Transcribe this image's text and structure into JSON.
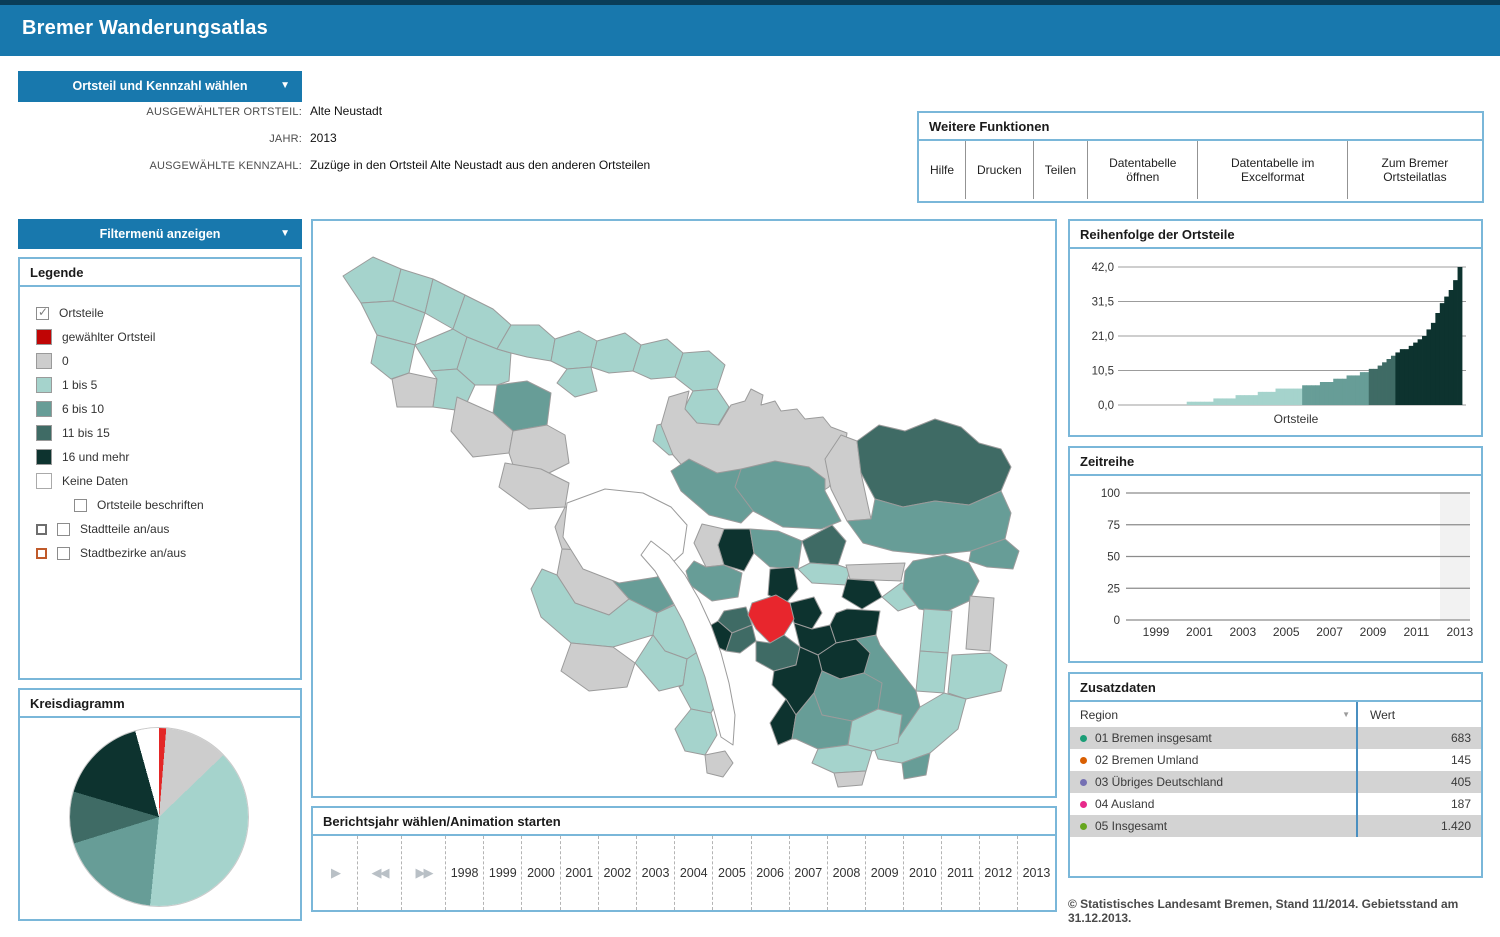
{
  "app": {
    "title": "Bremer Wanderungsatlas"
  },
  "selector": {
    "label": "Ortsteil und Kennzahl wählen",
    "caret": "▼"
  },
  "filter": {
    "label": "Filtermenü anzeigen",
    "caret": "▼"
  },
  "info": {
    "fields": [
      {
        "label": "AUSGEWÄHLTER ORTSTEIL:",
        "value": "Alte Neustadt"
      },
      {
        "label": "JAHR:",
        "value": "2013"
      },
      {
        "label": "AUSGEWÄHLTE KENNZAHL:",
        "value": "Zuzüge in den Ortsteil Alte Neustadt aus den anderen Ortsteilen"
      }
    ]
  },
  "panels": {
    "functions": "Weitere Funktionen",
    "legend": "Legende",
    "pie": "Kreisdiagramm",
    "ranking": "Reihenfolge der Ortsteile",
    "zeit": "Zeitreihe",
    "zusatz": "Zusatzdaten",
    "yearbar": "Berichtsjahr wählen/Animation starten"
  },
  "functions": {
    "buttons": [
      "Hilfe",
      "Drucken",
      "Teilen",
      "Datentabelle öffnen",
      "Datentabelle im Excelformat",
      "Zum Bremer Ortsteilatlas"
    ]
  },
  "legend": {
    "items": [
      {
        "kind": "check",
        "checked": true,
        "label": "Ortsteile"
      },
      {
        "kind": "swatch",
        "color": "#c00505",
        "label": "gewählter Ortsteil"
      },
      {
        "kind": "swatch",
        "color": "#cdcdcd",
        "label": "0"
      },
      {
        "kind": "swatch",
        "color": "#a5d3cc",
        "label": "1 bis 5"
      },
      {
        "kind": "swatch",
        "color": "#679d97",
        "label": "6 bis 10"
      },
      {
        "kind": "swatch",
        "color": "#3f6b65",
        "label": "11 bis 15"
      },
      {
        "kind": "swatch",
        "color": "#0d332f",
        "label": "16 und mehr"
      },
      {
        "kind": "swatch",
        "color": "#ffffff",
        "label": "Keine Daten"
      },
      {
        "kind": "sub-check",
        "label": "Ortsteile beschriften"
      },
      {
        "kind": "pair",
        "box": "#6e6e6e",
        "label": "Stadtteile an/aus"
      },
      {
        "kind": "pair",
        "box": "#c05a2a",
        "label": "Stadtbezirke an/aus"
      }
    ]
  },
  "chart_data": [
    {
      "id": "ranking",
      "type": "bar",
      "title": "Reihenfolge der Ortsteile",
      "xlabel": "Ortsteile",
      "ylim": [
        0,
        42
      ],
      "ytick_labels": [
        "0,0",
        "10,5",
        "21,0",
        "31,5",
        "42,0"
      ],
      "yticks": [
        0,
        10.5,
        21,
        31.5,
        42
      ],
      "grid": true,
      "sorted": "ascending",
      "values": [
        0,
        0,
        0,
        0,
        0,
        0,
        0,
        0,
        0,
        0,
        0,
        0,
        0,
        1,
        1,
        1,
        1,
        1,
        1,
        2,
        2,
        2,
        2,
        2,
        3,
        3,
        3,
        3,
        3,
        4,
        4,
        4,
        4,
        5,
        5,
        5,
        5,
        5,
        5,
        6,
        6,
        6,
        6,
        7,
        7,
        7,
        8,
        8,
        8,
        9,
        9,
        9,
        10,
        10,
        11,
        11,
        12,
        13,
        14,
        15,
        16,
        17,
        17,
        18,
        19,
        20,
        21,
        23,
        25,
        28,
        31,
        33,
        35,
        38,
        42
      ],
      "class_colors": {
        "1-5": "#a5d3cc",
        "6-10": "#679d97",
        "11-15": "#3f6b65",
        "16+": "#0d332f"
      }
    },
    {
      "id": "pie",
      "type": "pie",
      "title": "Kreisdiagramm",
      "slices": [
        {
          "label": "gewählter Ortsteil",
          "pct": 1.3,
          "color": "#e32726"
        },
        {
          "label": "0",
          "pct": 11.5,
          "color": "#cdcdcd"
        },
        {
          "label": "1 bis 5",
          "pct": 38.8,
          "color": "#a5d3cc"
        },
        {
          "label": "6 bis 10",
          "pct": 18.6,
          "color": "#679d97"
        },
        {
          "label": "11 bis 15",
          "pct": 9.4,
          "color": "#3f6b65"
        },
        {
          "label": "16 und mehr",
          "pct": 16.1,
          "color": "#0d332f"
        },
        {
          "label": "Keine Daten",
          "pct": 4.3,
          "color": "#ffffff"
        }
      ]
    },
    {
      "id": "zeitreihe",
      "type": "line",
      "title": "Zeitreihe",
      "ylim": [
        0,
        100
      ],
      "yticks": [
        0,
        25,
        50,
        75,
        100
      ],
      "xticks": [
        1999,
        2001,
        2003,
        2005,
        2007,
        2009,
        2011,
        2013
      ],
      "series": [],
      "highlight_x": 2013,
      "grid": true
    }
  ],
  "zusatz": {
    "columns": {
      "region": "Region",
      "wert": "Wert"
    },
    "sort_icon": "▼",
    "rows": [
      {
        "dot": "#1b9e77",
        "region": "01 Bremen insgesamt",
        "wert": "683"
      },
      {
        "dot": "#d95f02",
        "region": "02 Bremen Umland",
        "wert": "145"
      },
      {
        "dot": "#7570b3",
        "region": "03 Übriges Deutschland",
        "wert": "405"
      },
      {
        "dot": "#e7298a",
        "region": "04 Ausland",
        "wert": "187"
      },
      {
        "dot": "#66a61e",
        "region": "05 Insgesamt",
        "wert": "1.420"
      }
    ]
  },
  "yearbar": {
    "controls": [
      {
        "name": "play",
        "glyph": "▶"
      },
      {
        "name": "step-back",
        "glyph": "◀◀"
      },
      {
        "name": "step-forward",
        "glyph": "▶▶"
      }
    ],
    "years": [
      "1998",
      "1999",
      "2000",
      "2001",
      "2002",
      "2003",
      "2004",
      "2005",
      "2006",
      "2007",
      "2008",
      "2009",
      "2010",
      "2011",
      "2012",
      "2013"
    ]
  },
  "footer": {
    "text": "© Statistisches Landesamt Bremen, Stand 11/2014. Gebietsstand am 31.12.2013."
  },
  "map": {
    "stroke": "#9b9b9b",
    "palette": {
      "L": "#a5d3cc",
      "M": "#679d97",
      "D": "#3f6b65",
      "K": "#0d332f",
      "G": "#cdcdcd",
      "W": "#ffffff",
      "R": "#e8262d"
    },
    "regions": [
      {
        "f": "L",
        "p": "30,55 60,36 88,48 80,80 48,82"
      },
      {
        "f": "L",
        "p": "88,48 120,58 112,92 80,80"
      },
      {
        "f": "L",
        "p": "48,82 80,80 112,92 102,124 64,114"
      },
      {
        "f": "L",
        "p": "120,58 152,74 140,108 112,92"
      },
      {
        "f": "L",
        "p": "64,114 102,124 96,152 78,158 58,142"
      },
      {
        "f": "G",
        "p": "79,158 96,152 124,158 120,186 84,186"
      },
      {
        "f": "L",
        "p": "102,124 140,108 154,116 144,148 118,150"
      },
      {
        "f": "L",
        "p": "152,74 180,88 198,104 184,128 154,116 140,108"
      },
      {
        "f": "L",
        "p": "124,158 118,150 144,148 162,164 150,190 120,186"
      },
      {
        "f": "M",
        "p": "184,164 214,160 238,172 234,204 200,210 180,192"
      },
      {
        "f": "L",
        "p": "154,116 184,128 198,132 196,160 184,164 162,164 144,148"
      },
      {
        "f": "L",
        "p": "198,104 226,104 242,118 238,140 214,136 198,132 184,128"
      },
      {
        "f": "L",
        "p": "242,118 266,110 284,120 278,146 254,148 238,140"
      },
      {
        "f": "L",
        "p": "254,148 278,146 284,170 262,176 244,162"
      },
      {
        "f": "L",
        "p": "284,120 312,112 328,124 320,150 296,152 278,146"
      },
      {
        "f": "L",
        "p": "328,124 354,118 370,132 362,156 338,158 320,150"
      },
      {
        "f": "L",
        "p": "370,132 396,130 412,144 404,168 380,170 362,156"
      },
      {
        "f": "L",
        "p": "380,170 404,168 416,186 404,206 382,204 370,190"
      },
      {
        "f": "G",
        "p": "144,176 180,192 200,210 196,232 160,236 138,210"
      },
      {
        "f": "G",
        "p": "200,210 234,204 252,214 256,242 228,256 200,244 196,232"
      },
      {
        "f": "L",
        "p": "344,204 372,198 386,210 380,232 356,234 340,220"
      },
      {
        "f": "L",
        "p": "386,210 412,204 428,212 424,234 398,236 380,232"
      },
      {
        "f": "G",
        "p": "356,176 376,170 372,188 384,202 406,204 418,184 432,180 438,168 450,174 448,184 462,180 468,190 484,188 492,198 510,196 518,206 534,212 530,240 516,266 488,284 452,288 416,280 384,262 360,234 348,204"
      },
      {
        "f": "G",
        "p": "528,214 544,220 548,252 554,280 558,298 534,300 518,268 512,238"
      },
      {
        "f": "D",
        "p": "544,220 566,204 592,210 622,198 648,206 666,222 688,228 698,246 688,270 656,284 622,280 590,286 562,278 548,252"
      },
      {
        "f": "M",
        "p": "534,300 558,298 562,278 590,286 622,280 656,284 688,270 698,292 692,318 658,330 620,334 580,330 550,322"
      },
      {
        "f": "M",
        "p": "658,330 692,318 706,330 700,348 674,346 656,340"
      },
      {
        "f": "M",
        "p": "428,248 462,240 496,246 512,258 512,270 528,300 508,308 470,306 440,290 422,266"
      },
      {
        "f": "M",
        "p": "376,238 404,252 428,248 422,266 440,290 428,302 396,294 368,270 358,250"
      },
      {
        "f": "G",
        "p": "389,303 411,308 405,324 411,344 393,346 381,322"
      },
      {
        "f": "K",
        "p": "411,308 437,308 441,332 431,350 411,344 405,324"
      },
      {
        "f": "M",
        "p": "381,340 393,346 411,344 429,352 425,376 399,380 377,364 373,350"
      },
      {
        "f": "M",
        "p": "437,308 465,310 489,320 485,348 457,346 441,332"
      },
      {
        "f": "D",
        "p": "489,320 519,304 533,320 525,344 497,342"
      },
      {
        "f": "L",
        "p": "497,342 525,344 537,348 533,364 499,362 485,348"
      },
      {
        "f": "G",
        "p": "533,344 592,342 588,360 537,358"
      },
      {
        "f": "K",
        "p": "534,358 561,360 569,376 549,388 529,376"
      },
      {
        "f": "L",
        "p": "569,376 588,362 612,364 608,382 585,390"
      },
      {
        "f": "M",
        "p": "600,340 632,334 656,342 666,360 656,380 630,392 606,388 590,368 592,350"
      },
      {
        "f": "M",
        "p": "523,422 543,418 563,414 567,424 603,470 607,486 585,518 559,522 537,492 527,458"
      },
      {
        "f": "K",
        "p": "517,404 523,392 534,388 567,390 563,414 543,418 523,422"
      },
      {
        "f": "L",
        "p": "611,388 639,390 635,432 607,430"
      },
      {
        "f": "L",
        "p": "607,430 635,432 631,472 603,470"
      },
      {
        "f": "G",
        "p": "657,375 681,377 677,430 653,428"
      },
      {
        "f": "L",
        "p": "639,434 677,432 694,444 688,470 653,478 635,472"
      },
      {
        "f": "L",
        "p": "559,522 585,518 607,486 631,472 653,478 645,508 617,532 589,542 565,538"
      },
      {
        "f": "M",
        "p": "589,542 617,532 613,554 591,558"
      },
      {
        "f": "K",
        "p": "457,348 481,346 485,368 473,382 455,374"
      },
      {
        "f": "D",
        "p": "411,390 433,386 439,404 419,412 405,400"
      },
      {
        "f": "K",
        "p": "405,400 419,412 413,430 395,422 391,408"
      },
      {
        "f": "D",
        "p": "419,412 439,404 443,420 427,432 413,430"
      },
      {
        "f": "K",
        "p": "477,382 501,376 509,392 499,408 481,402"
      },
      {
        "f": "K",
        "p": "481,402 499,408 517,404 523,422 505,434 487,426"
      },
      {
        "f": "D",
        "p": "443,420 457,422 471,414 487,426 483,444 461,450 443,440"
      },
      {
        "f": "K",
        "p": "505,434 523,422 543,418 557,432 551,452 527,458 509,450"
      },
      {
        "f": "K",
        "p": "461,450 483,444 487,426 505,434 509,450 501,472 483,494 473,478 459,464"
      },
      {
        "f": "K",
        "p": "473,478 483,494 479,518 465,524 457,502"
      },
      {
        "f": "M",
        "p": "509,450 527,458 551,452 569,462 565,488 539,500 509,494 501,472"
      },
      {
        "f": "M",
        "p": "501,472 509,494 539,500 535,524 505,528 483,518 479,518 483,494"
      },
      {
        "f": "L",
        "p": "539,500 565,488 589,494 585,522 559,530 535,524"
      },
      {
        "f": "L",
        "p": "505,528 535,524 559,530 553,550 521,552 499,542"
      },
      {
        "f": "G",
        "p": "521,552 553,550 549,564 525,566"
      },
      {
        "f": "G",
        "p": "192,242 228,248 256,262 252,286 216,288 186,266"
      },
      {
        "f": "G",
        "p": "252,286 292,290 284,330 249,328 242,306"
      },
      {
        "f": "M",
        "p": "289,306 320,298 348,308 342,336 312,342 284,330"
      },
      {
        "f": "M",
        "p": "312,342 342,336 356,352 366,380 344,392 316,378 300,360"
      },
      {
        "f": "G",
        "p": "249,328 284,330 312,342 300,360 316,378 296,394 262,382 244,354"
      },
      {
        "f": "L",
        "p": "229,348 244,354 262,382 296,394 316,378 344,392 340,414 300,426 258,422 228,396 218,368"
      },
      {
        "f": "G",
        "p": "258,422 300,426 322,442 314,466 276,470 248,450"
      },
      {
        "f": "L",
        "p": "344,392 366,382 382,400 392,426 374,438 352,430 340,414"
      },
      {
        "f": "L",
        "p": "340,414 352,430 374,438 370,464 346,470 322,442"
      },
      {
        "f": "L",
        "p": "374,438 392,426 402,446 410,470 398,492 378,488 366,466 370,464"
      },
      {
        "f": "L",
        "p": "378,488 398,492 404,514 392,534 372,530 362,508"
      },
      {
        "f": "G",
        "p": "392,534 412,530 420,542 410,556 394,552"
      },
      {
        "f": "W",
        "p": "254,282 292,268 330,272 358,286 374,304 370,332 344,356 306,362 270,348 250,316"
      },
      {
        "f": "W",
        "p": "338,320 356,334 372,354 386,378 398,404 408,432 416,462 422,494 420,524 408,516 400,486 392,456 382,428 370,400 356,374 342,350 328,334"
      },
      {
        "f": "R",
        "p": "439,382 463,374 477,382 481,398 471,414 457,422 443,408 435,394",
        "selected": true
      }
    ]
  }
}
